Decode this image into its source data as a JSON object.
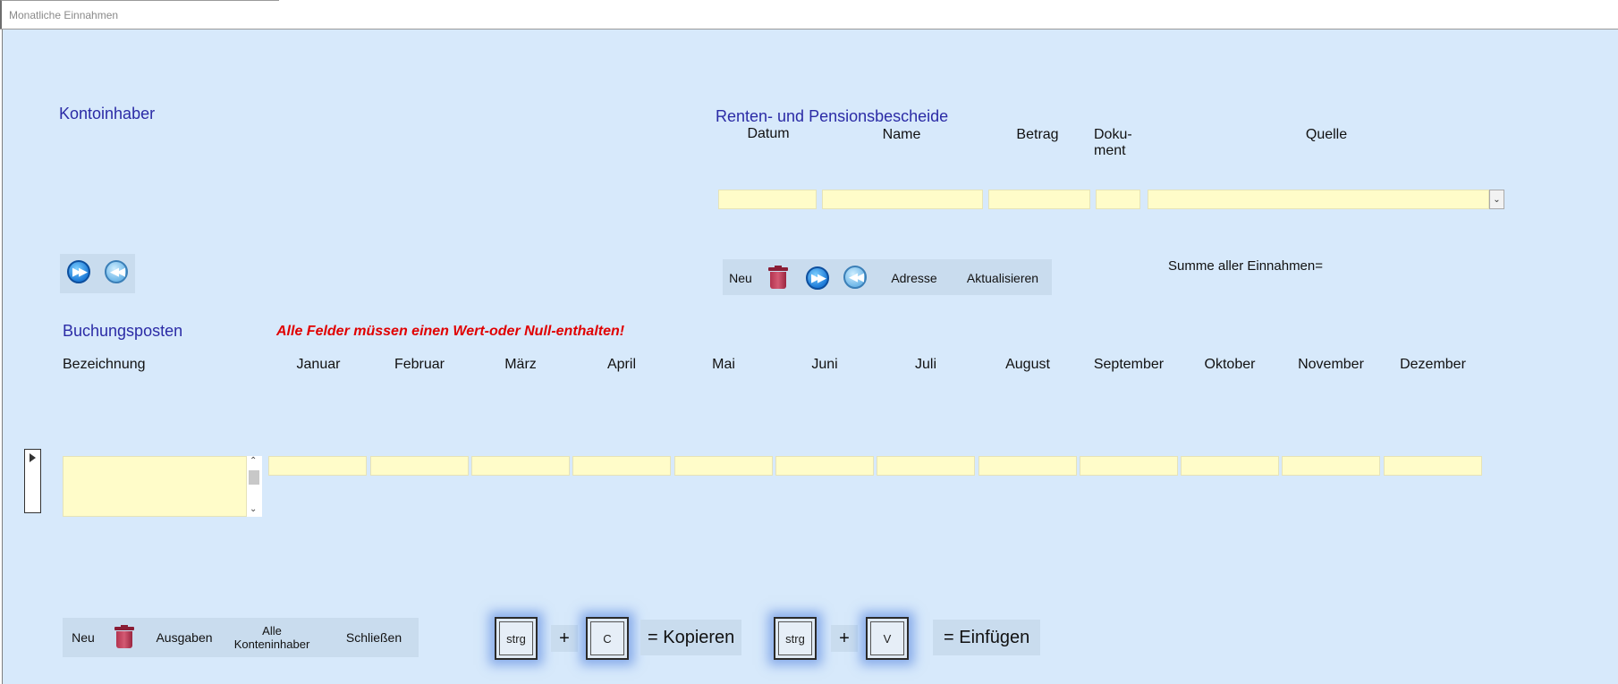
{
  "window": {
    "tab_title": "Monatliche Einnahmen"
  },
  "kontoinhaber": {
    "heading": "Kontoinhaber"
  },
  "renten": {
    "heading": "Renten- und Pensionsbescheide",
    "columns": [
      "Datum",
      "Name",
      "Betrag",
      "Doku-\nment",
      "Quelle"
    ],
    "values": {
      "datum": "",
      "name": "",
      "betrag": "",
      "dokument": "",
      "quelle": ""
    }
  },
  "nav_top": {
    "forward_icon": "fast-forward-icon",
    "back_icon": "rewind-icon"
  },
  "renten_toolbar": {
    "neu": "Neu",
    "adresse": "Adresse",
    "aktualisieren": "Aktualisieren",
    "trash_icon": "trash-icon"
  },
  "summe": {
    "label": "Summe aller Einnahmen="
  },
  "buchung": {
    "heading": "Buchungsposten",
    "warning": "Alle Felder müssen einen Wert-oder Null-enthalten!",
    "bezeichnung_label": "Bezeichnung",
    "months": [
      "Januar",
      "Februar",
      "März",
      "April",
      "Mai",
      "Juni",
      "Juli",
      "August",
      "September",
      "Oktober",
      "November",
      "Dezember"
    ],
    "values": [
      "",
      "",
      "",
      "",
      "",
      "",
      "",
      "",
      "",
      "",
      "",
      ""
    ],
    "bezeichnung_value": ""
  },
  "bottom_toolbar": {
    "neu": "Neu",
    "ausgaben": "Ausgaben",
    "alle_konteninhaber_1": "Alle",
    "alle_konteninhaber_2": "Konteninhaber",
    "schliessen": "Schließen"
  },
  "shortcuts": {
    "key1": "strg",
    "plus1": "+",
    "key2": "C",
    "label_copy": "= Kopieren",
    "key3": "strg",
    "plus2": "+",
    "key4": "V",
    "label_paste": "= Einfügen"
  },
  "colors": {
    "background": "#d7e9fb",
    "field": "#fffcc9",
    "heading": "#2b2ba6",
    "warning": "#e00000"
  }
}
